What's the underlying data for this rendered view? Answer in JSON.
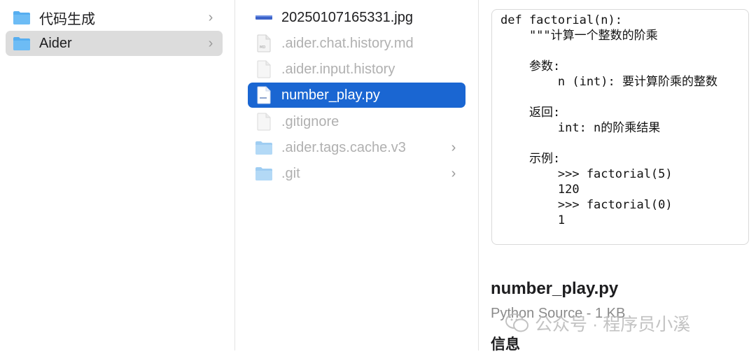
{
  "sidebar": {
    "items": [
      {
        "label": "代码生成",
        "icon": "folder-icon"
      },
      {
        "label": "Aider",
        "icon": "folder-icon"
      }
    ]
  },
  "files": {
    "items": [
      {
        "label": "20250107165331.jpg",
        "icon": "image-file-icon"
      },
      {
        "label": ".aider.chat.history.md",
        "icon": "markdown-file-icon"
      },
      {
        "label": ".aider.input.history",
        "icon": "file-icon"
      },
      {
        "label": "number_play.py",
        "icon": "python-file-icon"
      },
      {
        "label": ".gitignore",
        "icon": "file-icon"
      },
      {
        "label": ".aider.tags.cache.v3",
        "icon": "folder-icon"
      },
      {
        "label": ".git",
        "icon": "folder-icon"
      }
    ]
  },
  "preview": {
    "code": "def factorial(n):\n    \"\"\"计算一个整数的阶乘\n\n    参数:\n        n (int): 要计算阶乘的整数\n\n    返回:\n        int: n的阶乘结果\n\n    示例:\n        >>> factorial(5)\n        120\n        >>> factorial(0)\n        1",
    "file_name": "number_play.py",
    "file_kind": "Python Source - 1 KB",
    "info_heading": "信息"
  },
  "watermark": "公众号 · 程序员小溪",
  "colors": {
    "selection": "#1a66d2",
    "folder": "#56aef0"
  }
}
